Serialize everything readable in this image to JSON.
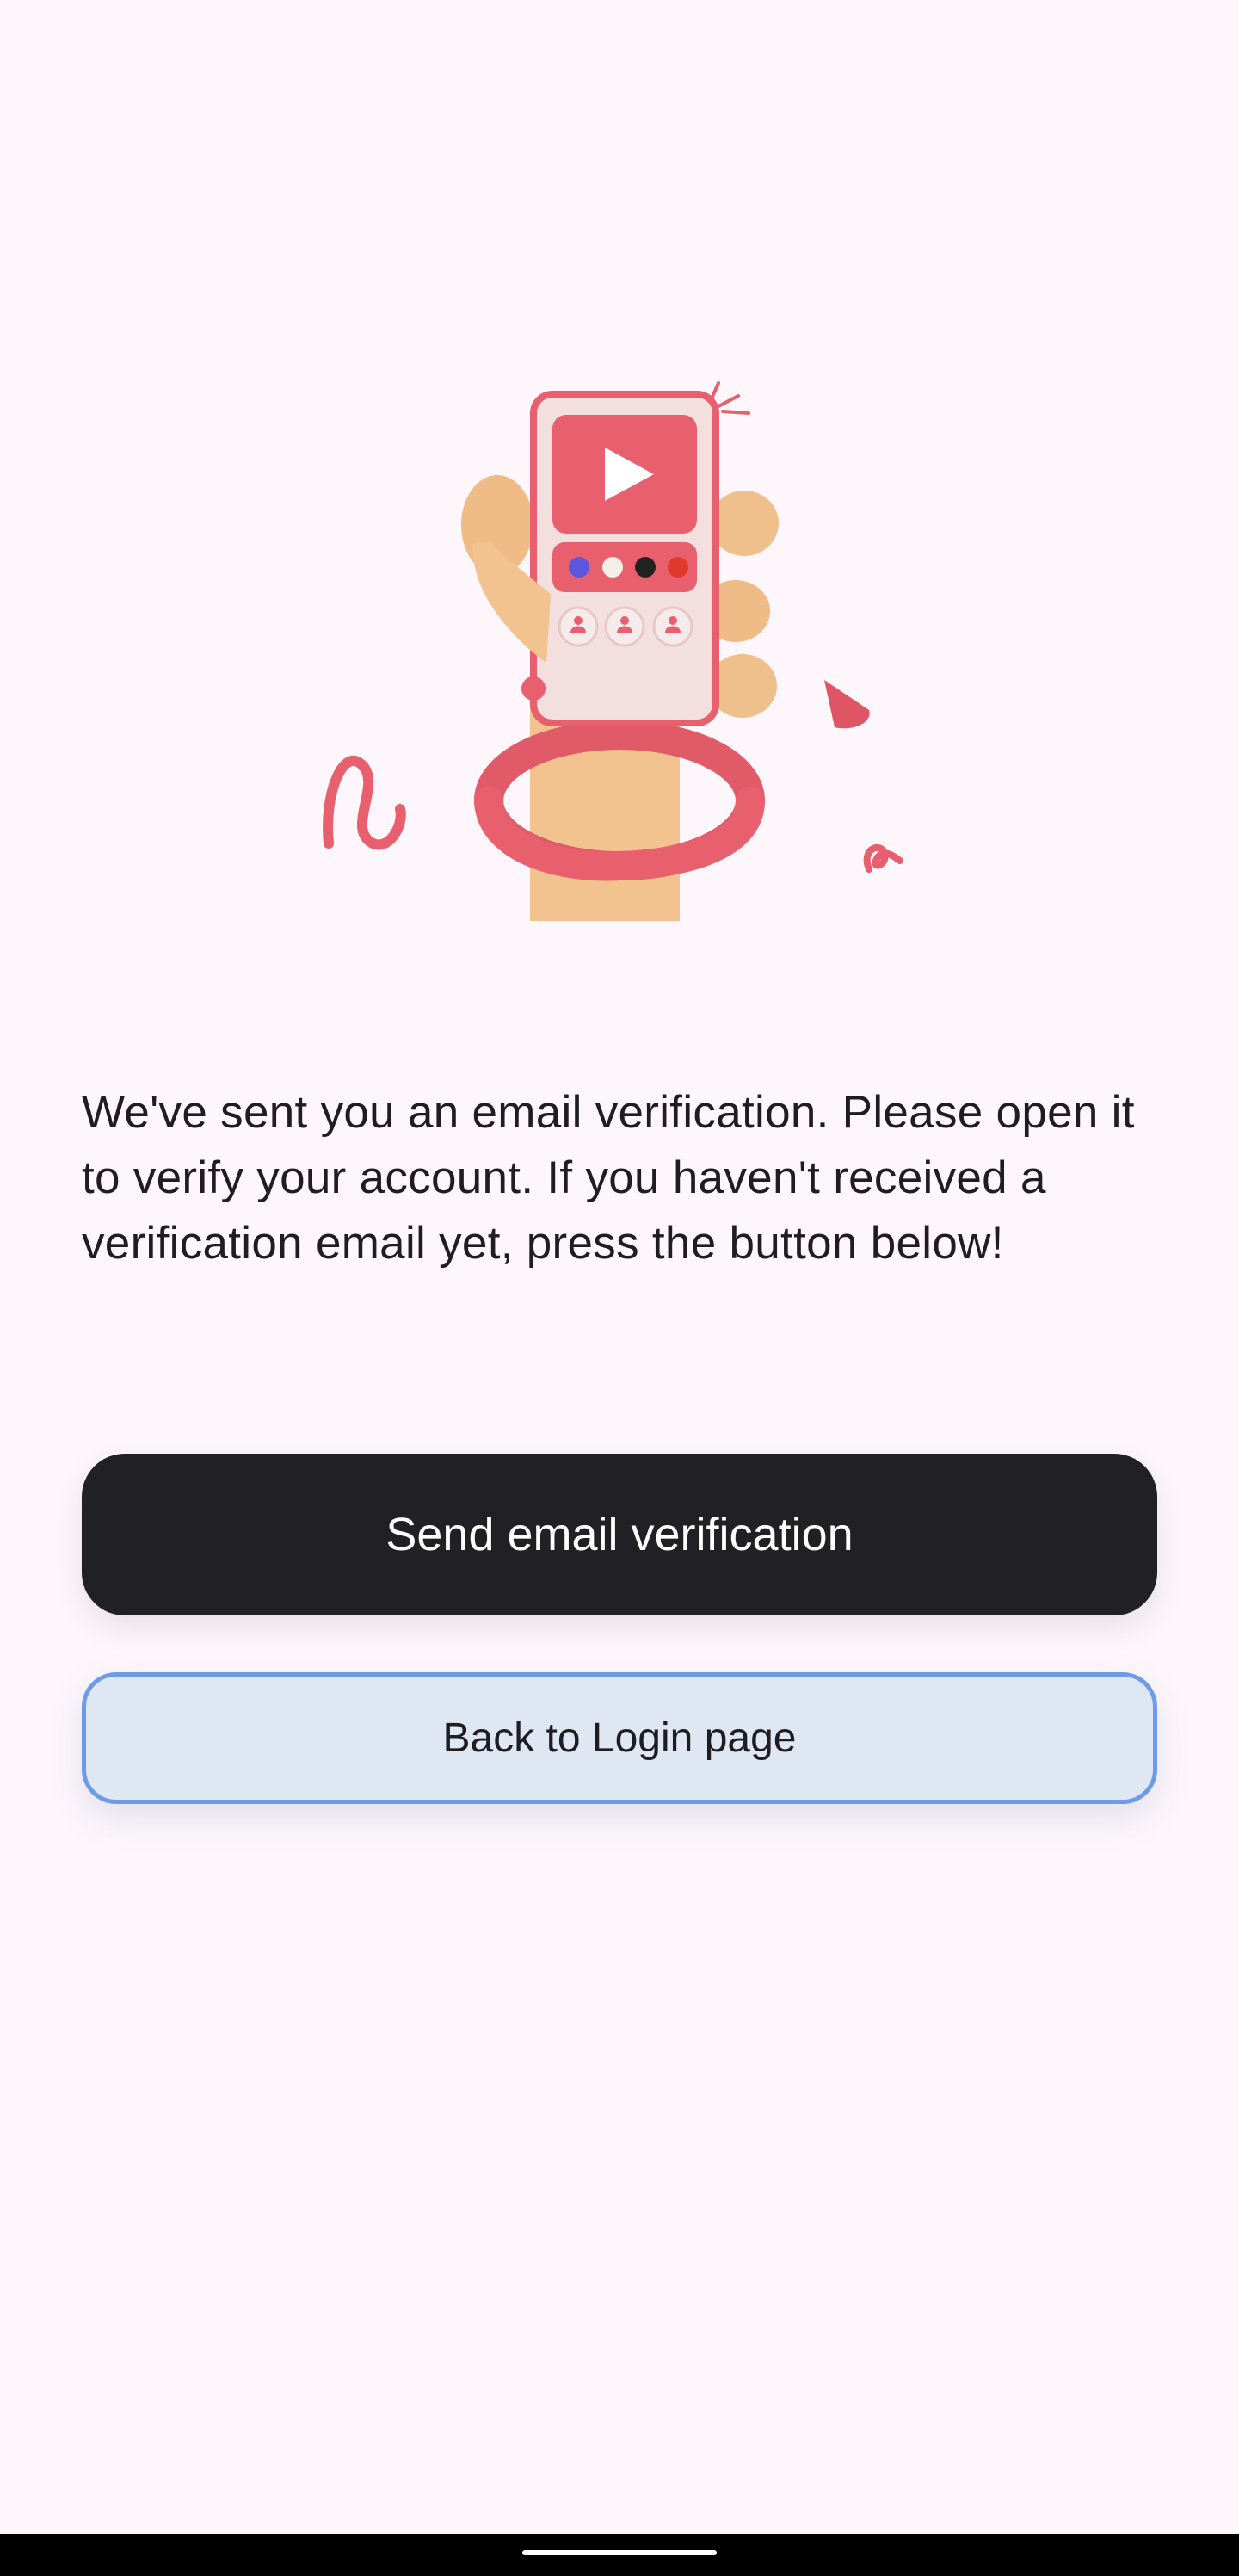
{
  "message": {
    "text": "We've sent you an email verification. Please open it to verify your account. If you haven't received a verification email yet, press the button below!"
  },
  "buttons": {
    "send_verification": "Send email verification",
    "back_to_login": "Back to Login page"
  },
  "icons": {
    "illustration": "hand-holding-phone-video-illustration",
    "nav_handle": "gesture-handle"
  },
  "colors": {
    "background": "#fdf7fc",
    "primary_button": "#212025",
    "secondary_button_bg": "#dfe7f3",
    "secondary_button_border": "#6e9be8",
    "accent": "#e8606e"
  }
}
